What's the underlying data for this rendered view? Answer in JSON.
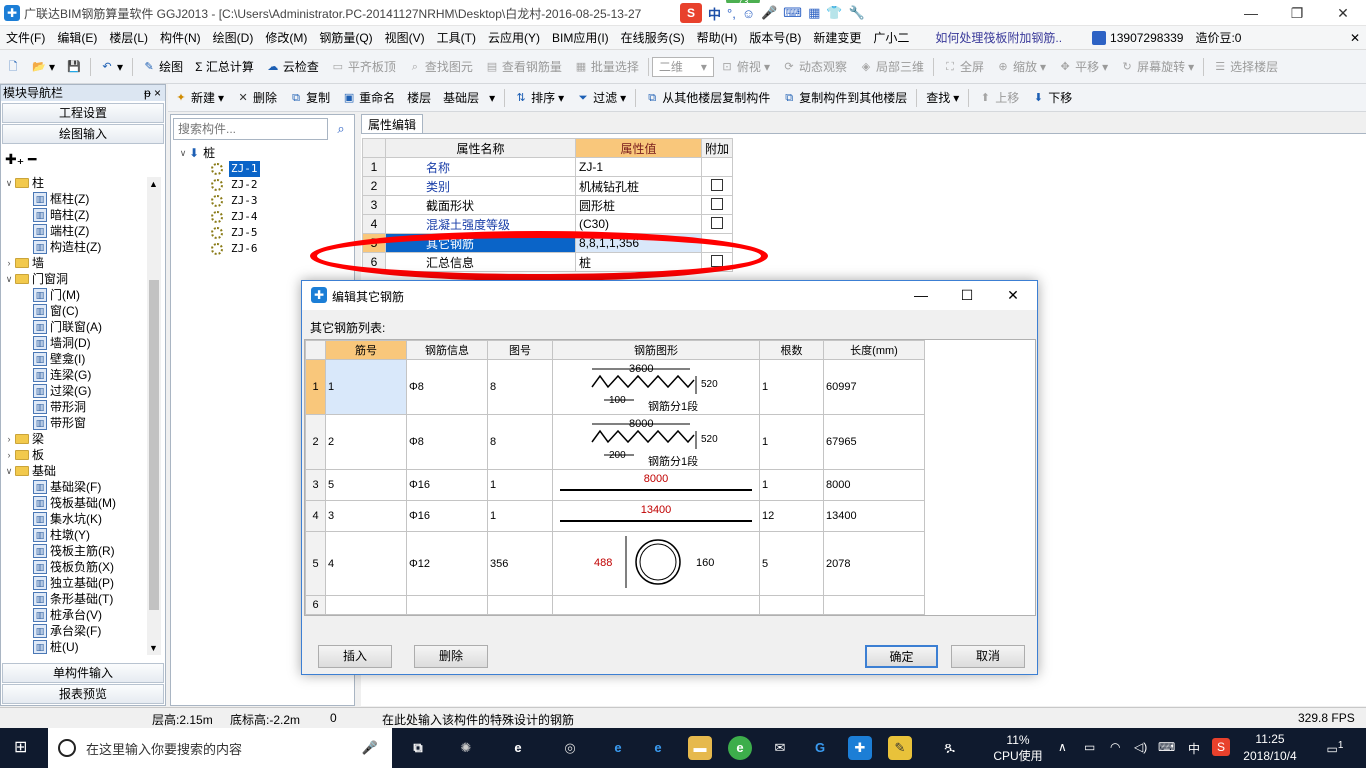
{
  "window": {
    "title": "广联达BIM钢筋算量软件 GGJ2013 - [C:\\Users\\Administrator.PC-20141127NRHM\\Desktop\\白龙村-2016-08-25-13-27",
    "min": "—",
    "restore": "❐",
    "close": "✕",
    "bubble": "73"
  },
  "ime": {
    "logo": "S",
    "mode": "中",
    "punct": "°,",
    "emoji": "☺",
    "mic": "🎤",
    "keyboard": "⌨",
    "skin": "▦",
    "shirt": "👕",
    "tools": "🔧"
  },
  "menu": [
    "文件(F)",
    "编辑(E)",
    "楼层(L)",
    "构件(N)",
    "绘图(D)",
    "修改(M)",
    "钢筋量(Q)",
    "视图(V)",
    "工具(T)",
    "云应用(Y)",
    "BIM应用(I)",
    "在线服务(S)",
    "帮助(H)",
    "版本号(B)",
    "新建变更",
    "广小二"
  ],
  "menu_extra": {
    "link": "如何处理筏板附加钢筋..",
    "phone": "13907298339",
    "price": "造价豆:0"
  },
  "toolbar1": [
    "绘图",
    "Σ 汇总计算",
    "云检查",
    "平齐板顶",
    "查找图元",
    "查看钢筋量",
    "批量选择",
    "二维",
    "俯视",
    "动态观察",
    "局部三维",
    "全屏",
    "缩放",
    "平移",
    "屏幕旋转",
    "选择楼层"
  ],
  "toolbar2": [
    "新建",
    "删除",
    "复制",
    "重命名",
    "楼层",
    "基础层",
    "排序",
    "过滤",
    "从其他楼层复制构件",
    "复制构件到其他楼层",
    "查找",
    "上移",
    "下移"
  ],
  "nav": {
    "title": "模块导航栏",
    "pin": "ᵽ ×",
    "btn_project": "工程设置",
    "btn_draw": "绘图输入",
    "btn_single": "单构件输入",
    "btn_report": "报表预览",
    "tree": [
      {
        "t": "folder",
        "label": "柱",
        "open": true
      },
      {
        "t": "leaf",
        "label": "框柱(Z)"
      },
      {
        "t": "leaf",
        "label": "暗柱(Z)"
      },
      {
        "t": "leaf",
        "label": "端柱(Z)"
      },
      {
        "t": "leaf",
        "label": "构造柱(Z)"
      },
      {
        "t": "folder",
        "label": "墙",
        "open": false
      },
      {
        "t": "folder",
        "label": "门窗洞",
        "open": true
      },
      {
        "t": "leaf",
        "label": "门(M)"
      },
      {
        "t": "leaf",
        "label": "窗(C)"
      },
      {
        "t": "leaf",
        "label": "门联窗(A)"
      },
      {
        "t": "leaf",
        "label": "墙洞(D)"
      },
      {
        "t": "leaf",
        "label": "壁龛(I)"
      },
      {
        "t": "leaf",
        "label": "连梁(G)"
      },
      {
        "t": "leaf",
        "label": "过梁(G)"
      },
      {
        "t": "leaf",
        "label": "带形洞"
      },
      {
        "t": "leaf",
        "label": "带形窗"
      },
      {
        "t": "folder",
        "label": "梁",
        "open": false
      },
      {
        "t": "folder",
        "label": "板",
        "open": false
      },
      {
        "t": "folder",
        "label": "基础",
        "open": true
      },
      {
        "t": "leaf",
        "label": "基础梁(F)"
      },
      {
        "t": "leaf",
        "label": "筏板基础(M)"
      },
      {
        "t": "leaf",
        "label": "集水坑(K)"
      },
      {
        "t": "leaf",
        "label": "柱墩(Y)"
      },
      {
        "t": "leaf",
        "label": "筏板主筋(R)"
      },
      {
        "t": "leaf",
        "label": "筏板负筋(X)"
      },
      {
        "t": "leaf",
        "label": "独立基础(P)"
      },
      {
        "t": "leaf",
        "label": "条形基础(T)"
      },
      {
        "t": "leaf",
        "label": "桩承台(V)"
      },
      {
        "t": "leaf",
        "label": "承台梁(F)"
      },
      {
        "t": "leaf",
        "label": "桩(U)"
      }
    ]
  },
  "components": {
    "search_placeholder": "搜索构件...",
    "root": "桩",
    "items": [
      "ZJ-1",
      "ZJ-2",
      "ZJ-3",
      "ZJ-4",
      "ZJ-5",
      "ZJ-6"
    ]
  },
  "props": {
    "tab": "属性编辑",
    "headers": [
      "属性名称",
      "属性值",
      "附加"
    ],
    "rows": [
      {
        "n": "1",
        "name": "名称",
        "value": "ZJ-1",
        "chk": false
      },
      {
        "n": "2",
        "name": "类别",
        "value": "机械钻孔桩",
        "chk": true
      },
      {
        "n": "3",
        "name": "截面形状",
        "value": "圆形桩",
        "chk": true
      },
      {
        "n": "4",
        "name": "混凝土强度等级",
        "value": "(C30)",
        "chk": true
      },
      {
        "n": "5",
        "name": "其它钢筋",
        "value": "8,8,1,1,356",
        "chk": false
      },
      {
        "n": "6",
        "name": "汇总信息",
        "value": "桩",
        "chk": true
      }
    ]
  },
  "dialog": {
    "title": "编辑其它钢筋",
    "list_label": "其它钢筋列表:",
    "headers": [
      "筋号",
      "钢筋信息",
      "图号",
      "钢筋图形",
      "根数",
      "长度(mm)"
    ],
    "rows": [
      {
        "n": "1",
        "no": "1",
        "info": "Φ8",
        "fig": "8",
        "count": "1",
        "len": "60997",
        "shape": {
          "kind": "zigzag",
          "top": "3600",
          "bottom": "100",
          "h": "520",
          "note": "钢筋分1段"
        }
      },
      {
        "n": "2",
        "no": "2",
        "info": "Φ8",
        "fig": "8",
        "count": "1",
        "len": "67965",
        "shape": {
          "kind": "zigzag",
          "top": "8000",
          "bottom": "200",
          "h": "520",
          "note": "钢筋分1段"
        }
      },
      {
        "n": "3",
        "no": "5",
        "info": "Φ16",
        "fig": "1",
        "count": "1",
        "len": "8000",
        "shape": {
          "kind": "line",
          "top": "8000"
        }
      },
      {
        "n": "4",
        "no": "3",
        "info": "Φ16",
        "fig": "1",
        "count": "12",
        "len": "13400",
        "shape": {
          "kind": "line",
          "top": "13400"
        }
      },
      {
        "n": "5",
        "no": "4",
        "info": "Φ12",
        "fig": "356",
        "count": "5",
        "len": "2078",
        "shape": {
          "kind": "spiral",
          "left": "488",
          "right": "160"
        }
      },
      {
        "n": "6",
        "no": "",
        "info": "",
        "fig": "",
        "count": "",
        "len": ""
      }
    ],
    "btn_insert": "插入",
    "btn_delete": "删除",
    "btn_ok": "确定",
    "btn_cancel": "取消"
  },
  "status": {
    "floor_h": "层高:2.15m",
    "base_h": "底标高:-2.2m",
    "zero": "0",
    "hint": "在此处输入该构件的特殊设计的钢筋",
    "fps": "329.8 FPS"
  },
  "taskbar": {
    "search": "在这里输入你要搜索的内容",
    "cpu": "11%",
    "cpu_label": "CPU使用",
    "ime": "中",
    "time": "11:25",
    "date": "2018/10/4",
    "notify": "1"
  },
  "colors": {
    "selected": "#0a64c8",
    "header_orange": "#f9c77b",
    "red": "#ff0000"
  }
}
